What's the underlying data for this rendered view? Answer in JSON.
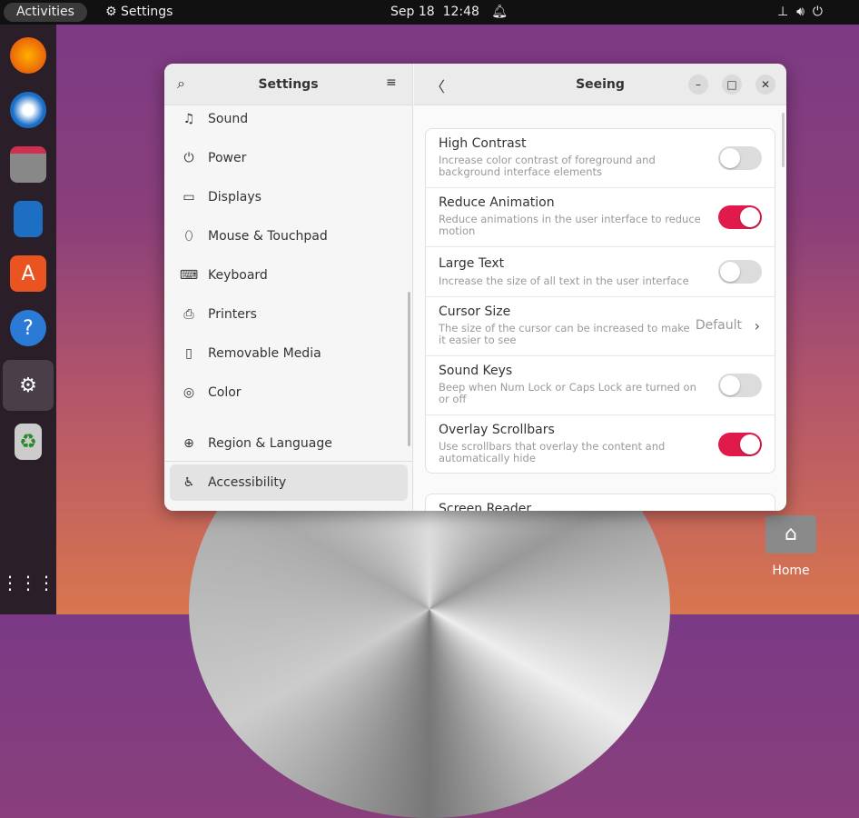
{
  "topbar": {
    "activities": "Activities",
    "app": "Settings",
    "date": "Sep 18",
    "time": "12:48"
  },
  "dock": [
    "firefox-icon",
    "thunderbird-icon",
    "files-icon",
    "writer-icon",
    "software-icon",
    "help-icon",
    "settings-icon",
    "trash-icon",
    "app-grid-icon"
  ],
  "desktop": {
    "home_label": "Home"
  },
  "sidebar": {
    "title": "Settings",
    "items": [
      {
        "label": "Sound",
        "icon": "♫"
      },
      {
        "label": "Power",
        "icon": "⏻"
      },
      {
        "label": "Displays",
        "icon": "▭"
      },
      {
        "label": "Mouse & Touchpad",
        "icon": "⬯"
      },
      {
        "label": "Keyboard",
        "icon": "⌨"
      },
      {
        "label": "Printers",
        "icon": "⎙"
      },
      {
        "label": "Removable Media",
        "icon": "▯"
      },
      {
        "label": "Color",
        "icon": "◎"
      },
      {
        "label": "Region & Language",
        "icon": "⊕"
      },
      {
        "label": "Accessibility",
        "icon": "♿"
      }
    ]
  },
  "main": {
    "title": "Seeing",
    "rows": [
      {
        "title": "High Contrast",
        "desc": "Increase color contrast of foreground and background interface elements",
        "on": false
      },
      {
        "title": "Reduce Animation",
        "desc": "Reduce animations in the user interface to reduce motion",
        "on": true
      },
      {
        "title": "Large Text",
        "desc": "Increase the size of all text in the user interface",
        "on": false
      },
      {
        "title": "Cursor Size",
        "desc": "The size of the cursor can be increased to make it easier to see",
        "value": "Default"
      },
      {
        "title": "Sound Keys",
        "desc": "Beep when Num Lock or Caps Lock are turned on or off",
        "on": false
      },
      {
        "title": "Overlay Scrollbars",
        "desc": "Use scrollbars that overlay the content and automatically hide",
        "on": true
      }
    ],
    "next_section": "Screen Reader"
  },
  "colors": {
    "accent": "#e01b4b"
  }
}
